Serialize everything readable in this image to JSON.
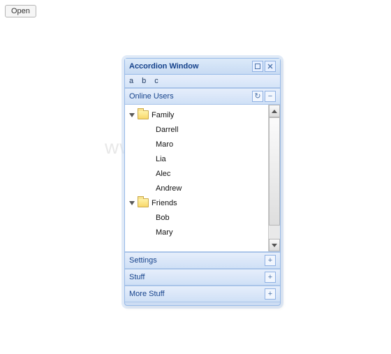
{
  "open_button": "Open",
  "watermark_text": "www.java2s.com",
  "window": {
    "title": "Accordion Window",
    "toolbar": {
      "items": [
        "a",
        "b",
        "c"
      ]
    },
    "panels": [
      {
        "title": "Online Users",
        "tools": [
          "refresh",
          "collapse"
        ],
        "expanded": true,
        "tree": [
          {
            "label": "Family",
            "type": "folder",
            "expanded": true,
            "children": [
              "Darrell",
              "Maro",
              "Lia",
              "Alec",
              "Andrew"
            ]
          },
          {
            "label": "Friends",
            "type": "folder",
            "expanded": true,
            "children": [
              "Bob",
              "Mary"
            ]
          }
        ]
      },
      {
        "title": "Settings",
        "tools": [
          "expand"
        ],
        "expanded": false
      },
      {
        "title": "Stuff",
        "tools": [
          "expand"
        ],
        "expanded": false
      },
      {
        "title": "More Stuff",
        "tools": [
          "expand"
        ],
        "expanded": false
      }
    ]
  },
  "icons": {
    "maximize": "⬜",
    "close": "✕",
    "refresh": "↻",
    "collapse": "−",
    "expand": "+"
  }
}
